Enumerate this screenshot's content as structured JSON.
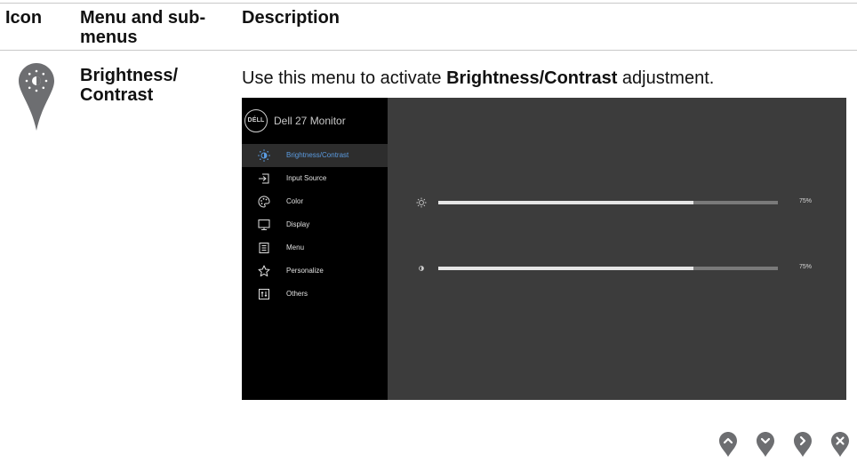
{
  "table": {
    "headers": {
      "icon": "Icon",
      "menu": "Menu and sub-menus",
      "description": "Description"
    }
  },
  "row": {
    "icon_name": "brightness-pin-icon",
    "menu_name": "Brightness/ Contrast",
    "description": {
      "prefix": "Use this menu to activate ",
      "bold": "Brightness/Contrast",
      "suffix": " adjustment."
    }
  },
  "osd": {
    "logo_text": "DÉLL",
    "title": "Dell 27 Monitor",
    "menu_items": [
      {
        "label": "Brightness/Contrast",
        "icon": "sun-icon",
        "selected": true
      },
      {
        "label": "Input Source",
        "icon": "input-source-icon",
        "selected": false
      },
      {
        "label": "Color",
        "icon": "palette-icon",
        "selected": false
      },
      {
        "label": "Display",
        "icon": "display-icon",
        "selected": false
      },
      {
        "label": "Menu",
        "icon": "menu-icon",
        "selected": false
      },
      {
        "label": "Personalize",
        "icon": "star-icon",
        "selected": false
      },
      {
        "label": "Others",
        "icon": "others-icon",
        "selected": false
      }
    ],
    "sliders": [
      {
        "name": "brightness",
        "icon": "sun-icon",
        "value_label": "75%",
        "level": 0.75
      },
      {
        "name": "contrast",
        "icon": "contrast-icon",
        "value_label": "75%",
        "level": 0.75
      }
    ],
    "selected_color": "#5b9be0"
  },
  "nav_buttons": [
    {
      "name": "up-button",
      "icon": "chevron-up-icon"
    },
    {
      "name": "down-button",
      "icon": "chevron-down-icon"
    },
    {
      "name": "right-button",
      "icon": "chevron-right-icon"
    },
    {
      "name": "close-button",
      "icon": "close-icon"
    }
  ]
}
